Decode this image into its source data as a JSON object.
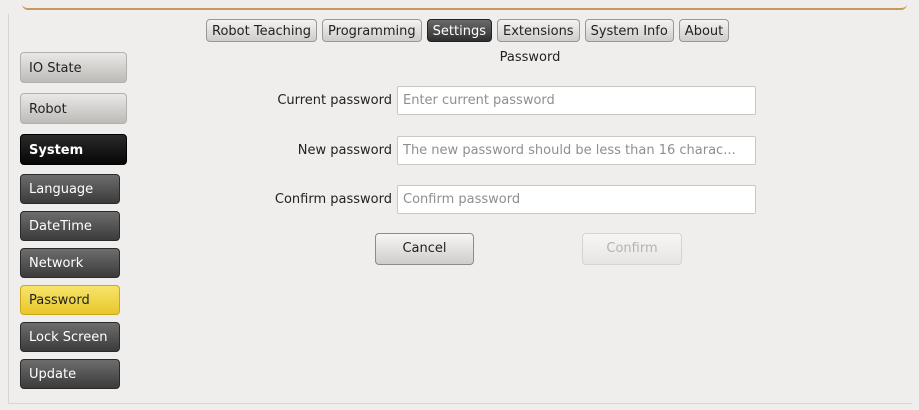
{
  "tabs": [
    {
      "label": "Robot Teaching",
      "active": false
    },
    {
      "label": "Programming",
      "active": false
    },
    {
      "label": "Settings",
      "active": true
    },
    {
      "label": "Extensions",
      "active": false
    },
    {
      "label": "System Info",
      "active": false
    },
    {
      "label": "About",
      "active": false
    }
  ],
  "sidebar": {
    "io_state": "IO State",
    "robot": "Robot",
    "system": "System",
    "items": [
      {
        "label": "Language"
      },
      {
        "label": "DateTime"
      },
      {
        "label": "Network"
      },
      {
        "label": "Password",
        "active": true
      },
      {
        "label": "Lock Screen"
      },
      {
        "label": "Update"
      }
    ]
  },
  "password_form": {
    "title": "Password",
    "current_label": "Current password",
    "current_placeholder": "Enter current password",
    "new_label": "New password",
    "new_placeholder": "The new password should be less than 16 charac...",
    "confirm_label": "Confirm password",
    "confirm_placeholder": "Confirm password",
    "cancel_label": "Cancel",
    "confirm_button_label": "Confirm"
  },
  "colors": {
    "active_sidebar": "#e8c72a",
    "active_tab": "#2f2f2f"
  }
}
